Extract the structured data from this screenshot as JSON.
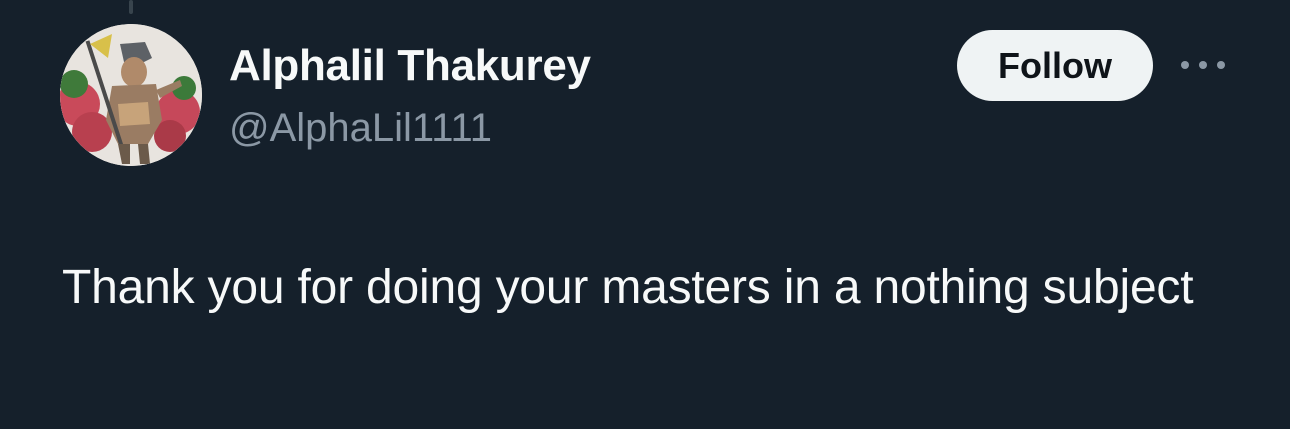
{
  "user": {
    "display_name": "Alphalil Thakurey",
    "handle": "@AlphaLil1111"
  },
  "actions": {
    "follow_label": "Follow"
  },
  "tweet": {
    "text": "Thank you for doing your masters in a nothing subject"
  },
  "icons": {
    "more": "more-horizontal-icon"
  },
  "colors": {
    "background": "#15202b",
    "primary_text": "#f7f9f9",
    "secondary_text": "#8b98a5",
    "follow_button_bg": "#eff3f4",
    "follow_button_text": "#0f1419"
  }
}
